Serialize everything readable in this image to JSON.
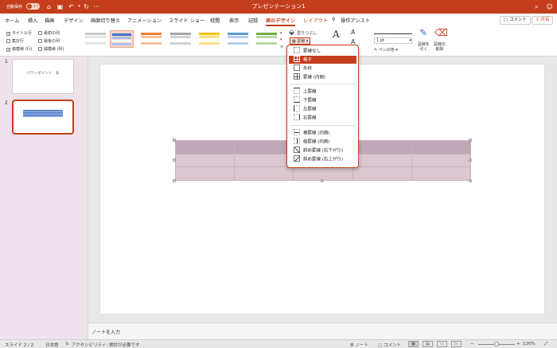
{
  "titlebar": {
    "autosave_label": "自動保存",
    "autosave_state": "オフ",
    "doc_title": "プレゼンテーション1",
    "more": "···"
  },
  "tabs": [
    "ホーム",
    "挿入",
    "描画",
    "デザイン",
    "画面切り替え",
    "アニメーション",
    "スライド ショー",
    "校閲",
    "表示",
    "記録",
    "表のデザイン",
    "レイアウト"
  ],
  "active_tab": "表のデザイン",
  "tell_me": "操作アシスト",
  "top_buttons": {
    "comment": "コメント",
    "share": "共有"
  },
  "ribbon": {
    "options": [
      {
        "label": "タイトル行",
        "checked": true
      },
      {
        "label": "最初の列",
        "checked": false
      },
      {
        "label": "集計行",
        "checked": false
      },
      {
        "label": "最後の列",
        "checked": false
      },
      {
        "label": "縞模様 (行)",
        "checked": true
      },
      {
        "label": "縞模様 (列)",
        "checked": false
      }
    ],
    "styles": [
      {
        "header": "#c9c9c9",
        "band": "#e4e4e4"
      },
      {
        "header": "#4472c4",
        "band": "#a9bfe6"
      },
      {
        "header": "#ed7d31",
        "band": "#f6c1a0"
      },
      {
        "header": "#a5a5a5",
        "band": "#d2d2d2"
      },
      {
        "header": "#ffc000",
        "band": "#ffe08a"
      },
      {
        "header": "#5b9bd5",
        "band": "#b3d0ec"
      },
      {
        "header": "#70ad47",
        "band": "#b8d9a0"
      }
    ],
    "shading_label": "塗りつぶし",
    "borders_label": "罫線",
    "pen_weight": "1 pt",
    "pen_color_label": "ペンの色",
    "draw_table_label": "罫線を\n引く",
    "eraser_label": "罫線の\n削除"
  },
  "accent_color": "#c43e1c",
  "slides": [
    {
      "number": "1",
      "title": "パワーポイント　表"
    },
    {
      "number": "2",
      "title": ""
    }
  ],
  "selected_slide": 2,
  "table": {
    "rows": 3,
    "cols": 5,
    "header_color": "#bfa7b6",
    "band_color": "#dcc6cf"
  },
  "notes_placeholder": "ノートを入力",
  "border_menu": {
    "items": [
      {
        "label": "罫線なし",
        "icon": "no-border-icon"
      },
      {
        "label": "格子",
        "icon": "all-borders-icon",
        "highlighted": true
      },
      {
        "label": "外枠",
        "icon": "outside-borders-icon"
      },
      {
        "label": "罫線 (内側)",
        "icon": "inside-borders-icon"
      },
      {
        "label": "上罫線",
        "icon": "top-border-icon"
      },
      {
        "label": "下罫線",
        "icon": "bottom-border-icon"
      },
      {
        "label": "左罫線",
        "icon": "left-border-icon"
      },
      {
        "label": "右罫線",
        "icon": "right-border-icon"
      },
      {
        "label": "横罫線 (内側)",
        "icon": "inside-horizontal-border-icon"
      },
      {
        "label": "縦罫線 (内側)",
        "icon": "inside-vertical-border-icon"
      },
      {
        "label": "斜め罫線 (右下がり)",
        "icon": "diagonal-down-border-icon"
      },
      {
        "label": "斜め罫線 (右上がり)",
        "icon": "diagonal-up-border-icon"
      }
    ]
  },
  "statusbar": {
    "slide_position": "スライド 2 / 2",
    "language": "日本語",
    "accessibility": "アクセシビリティ: 検討が必要です",
    "notes": "ノート",
    "comments": "コメント",
    "zoom": "120%"
  }
}
